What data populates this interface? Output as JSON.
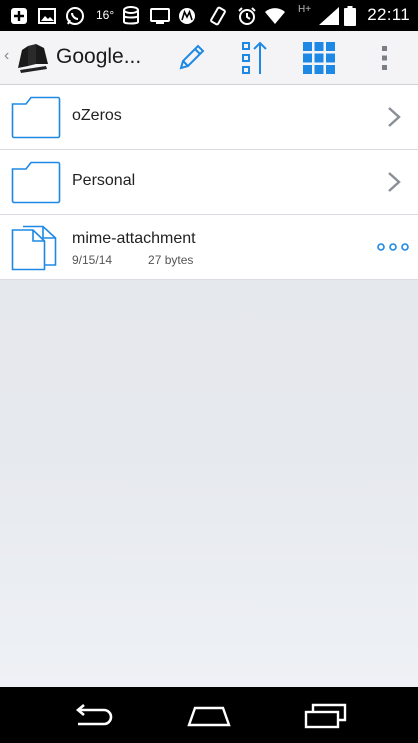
{
  "status_bar": {
    "temperature": "16°",
    "network_label": "H+",
    "time": "22:11",
    "icons": [
      "add-notification-icon",
      "image-icon",
      "whatsapp-icon",
      "database-icon",
      "screen-icon",
      "motorola-icon",
      "rotate-icon",
      "alarm-icon",
      "wifi-icon",
      "signal-icon",
      "battery-icon"
    ]
  },
  "action_bar": {
    "title": "Google...",
    "buttons": [
      "edit-icon",
      "sort-icon",
      "grid-view-icon",
      "overflow-menu-icon"
    ],
    "accent_color": "#1e88e5"
  },
  "items": [
    {
      "type": "folder",
      "name": "oZeros"
    },
    {
      "type": "folder",
      "name": "Personal"
    },
    {
      "type": "file",
      "name": "mime-attachment",
      "date": "9/15/14",
      "size": "27 bytes"
    }
  ],
  "nav_bar": {
    "buttons": [
      "back-icon",
      "home-icon",
      "recents-icon"
    ]
  }
}
